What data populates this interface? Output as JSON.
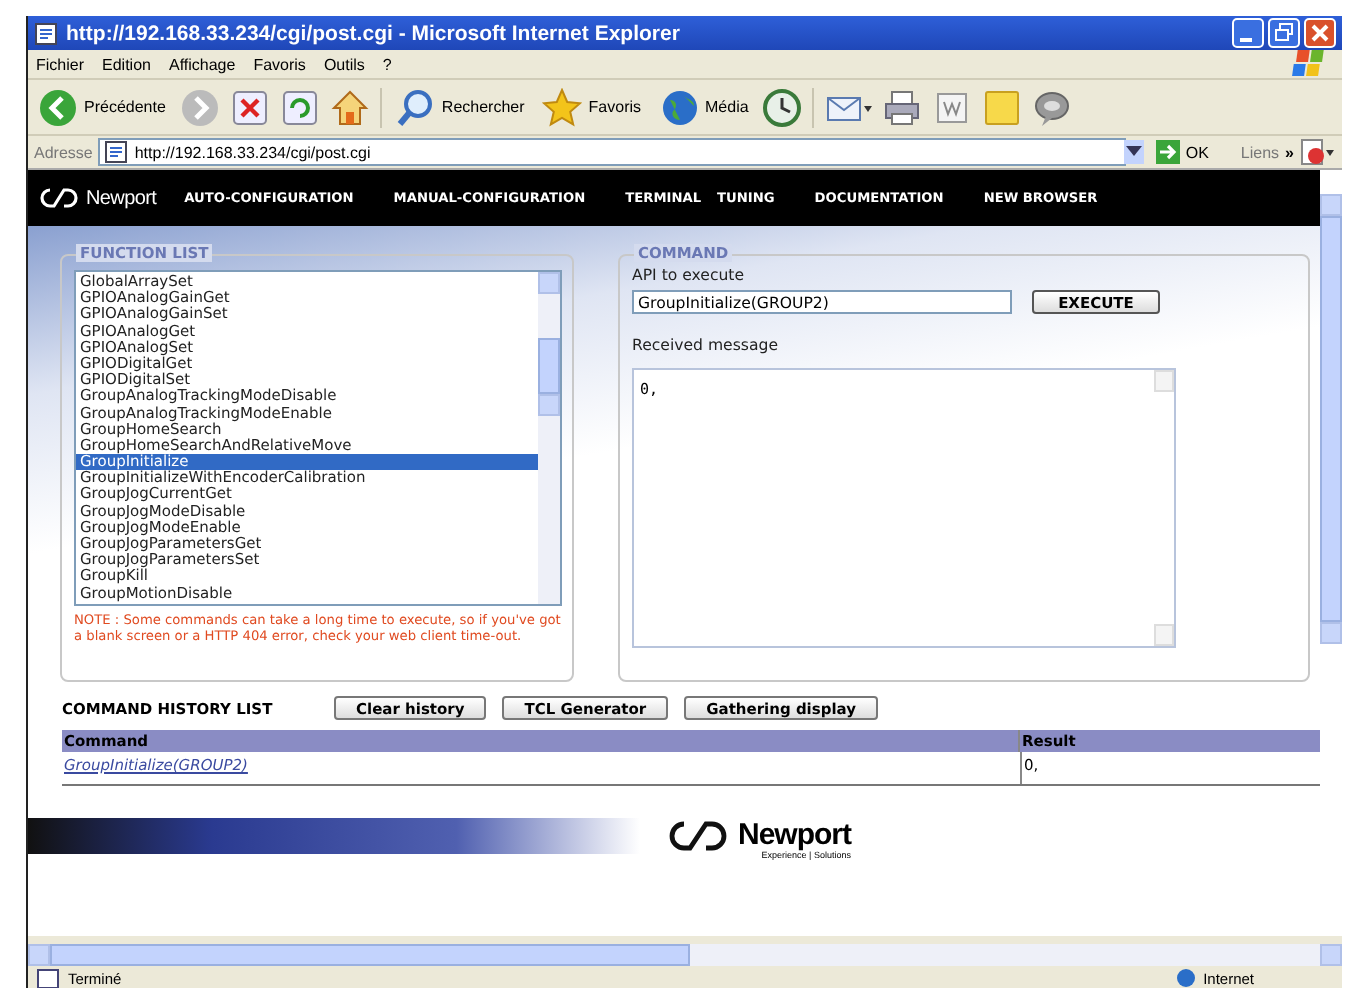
{
  "window": {
    "title": "http://192.168.33.234/cgi/post.cgi - Microsoft Internet Explorer"
  },
  "menu": [
    "Fichier",
    "Edition",
    "Affichage",
    "Favoris",
    "Outils",
    "?"
  ],
  "toolbar": [
    {
      "kind": "back",
      "label": "Précédente"
    },
    {
      "kind": "forward"
    },
    {
      "kind": "stop"
    },
    {
      "kind": "refresh"
    },
    {
      "kind": "home"
    },
    {
      "kind": "search",
      "label": "Rechercher"
    },
    {
      "kind": "favorites",
      "label": "Favoris"
    },
    {
      "kind": "media",
      "label": "Média"
    },
    {
      "kind": "history"
    },
    {
      "kind": "mail"
    },
    {
      "kind": "print"
    },
    {
      "kind": "edit"
    },
    {
      "kind": "note"
    },
    {
      "kind": "messenger"
    }
  ],
  "address": {
    "label": "Adresse",
    "value": "http://192.168.33.234/cgi/post.cgi",
    "go": "OK",
    "links": "Liens",
    "more": "»"
  },
  "nav": {
    "brand": "Newport",
    "items": [
      "AUTO-CONFIGURATION",
      "MANUAL-CONFIGURATION",
      "TERMINAL",
      "TUNING",
      "DOCUMENTATION",
      "NEW BROWSER"
    ]
  },
  "function_list": {
    "title": "FUNCTION LIST",
    "items": [
      {
        "label": "GlobalArraySet",
        "selected": false
      },
      {
        "label": "GPIOAnalogGainGet",
        "selected": false
      },
      {
        "label": "GPIOAnalogGainSet",
        "selected": false
      },
      {
        "label": "GPIOAnalogGet",
        "selected": false
      },
      {
        "label": "GPIOAnalogSet",
        "selected": false
      },
      {
        "label": "GPIODigitalGet",
        "selected": false
      },
      {
        "label": "GPIODigitalSet",
        "selected": false
      },
      {
        "label": "GroupAnalogTrackingModeDisable",
        "selected": false
      },
      {
        "label": "GroupAnalogTrackingModeEnable",
        "selected": false
      },
      {
        "label": "GroupHomeSearch",
        "selected": false
      },
      {
        "label": "GroupHomeSearchAndRelativeMove",
        "selected": false
      },
      {
        "label": "GroupInitialize",
        "selected": true
      },
      {
        "label": "GroupInitializeWithEncoderCalibration",
        "selected": false
      },
      {
        "label": "GroupJogCurrentGet",
        "selected": false
      },
      {
        "label": "GroupJogModeDisable",
        "selected": false
      },
      {
        "label": "GroupJogModeEnable",
        "selected": false
      },
      {
        "label": "GroupJogParametersGet",
        "selected": false
      },
      {
        "label": "GroupJogParametersSet",
        "selected": false
      },
      {
        "label": "GroupKill",
        "selected": false
      },
      {
        "label": "GroupMotionDisable",
        "selected": false
      }
    ],
    "note": "NOTE : Some commands can take a long time to execute, so if you've got a blank screen or a HTTP 404 error, check your web client time-out."
  },
  "command": {
    "title": "COMMAND",
    "api_label": "API to execute",
    "api_value": "GroupInitialize(GROUP2)",
    "execute": "EXECUTE",
    "received_label": "Received message",
    "received_value": "0,"
  },
  "history": {
    "title": "COMMAND HISTORY LIST",
    "buttons": [
      "Clear history",
      "TCL Generator",
      "Gathering display"
    ],
    "columns": [
      "Command",
      "Result"
    ],
    "rows": [
      {
        "command": "GroupInitialize(GROUP2)",
        "result": "0,"
      }
    ]
  },
  "footer": {
    "brand": "Newport",
    "tagline": "Experience | Solutions"
  },
  "status_bar": {
    "text": "Terminé",
    "zone": "Internet"
  }
}
